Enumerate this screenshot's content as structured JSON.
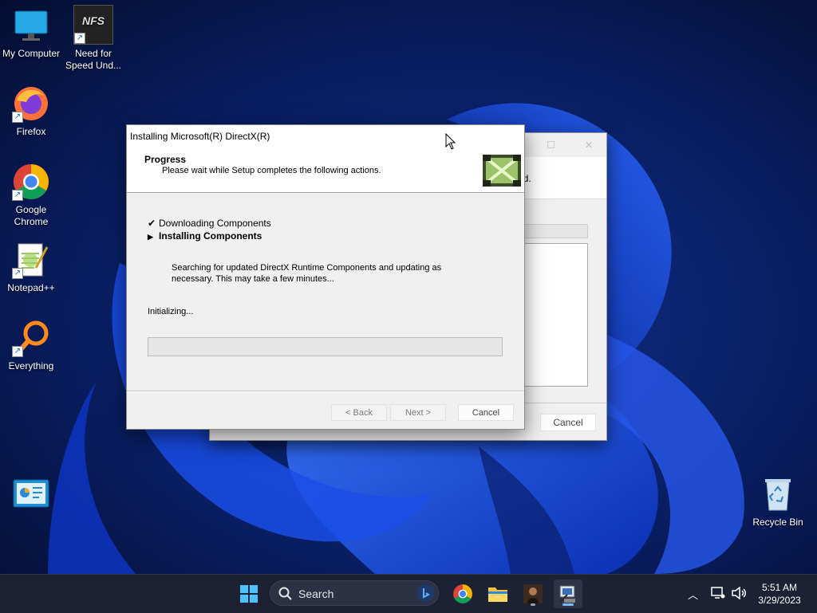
{
  "desktop": {
    "icons": [
      {
        "label": "My Computer",
        "icon": "monitor-icon"
      },
      {
        "label": "Need for Speed Und...",
        "icon": "nfs-game-icon",
        "brand": "NFS"
      },
      {
        "label": "Firefox",
        "icon": "firefox-icon"
      },
      {
        "label": "Google Chrome",
        "icon": "chrome-icon"
      },
      {
        "label": "Notepad++",
        "icon": "notepadpp-icon"
      },
      {
        "label": "Everything",
        "icon": "everything-search-icon"
      },
      {
        "label": "",
        "icon": "control-panel-icon"
      },
      {
        "label": "Recycle Bin",
        "icon": "recycle-bin-icon"
      }
    ]
  },
  "background_window": {
    "partial_text": "ed.",
    "cancel_label": "Cancel"
  },
  "installer": {
    "title": "Installing Microsoft(R) DirectX(R)",
    "header_title": "Progress",
    "header_subtitle": "Please wait while Setup completes the following actions.",
    "steps": [
      {
        "label": "Downloading Components",
        "state": "done",
        "marker": "✔"
      },
      {
        "label": "Installing Components",
        "state": "active",
        "marker": "▶"
      }
    ],
    "description": "Searching for updated DirectX Runtime Components and updating as necessary. This may take a few minutes...",
    "status": "Initializing...",
    "progress": 0,
    "buttons": {
      "back": "< Back",
      "next": "Next >",
      "cancel": "Cancel"
    }
  },
  "taskbar": {
    "search_label": "Search",
    "apps": [
      "start-icon",
      "chrome-icon",
      "file-explorer-icon",
      "game-app-icon",
      "setup-app-icon"
    ],
    "time": "5:51 AM",
    "date": "3/29/2023"
  },
  "colors": {
    "accent": "#0067c0",
    "taskbar": "#1c2233",
    "wallpaper_dark": "#071640",
    "wallpaper_bloom": "#1f4fe0"
  }
}
